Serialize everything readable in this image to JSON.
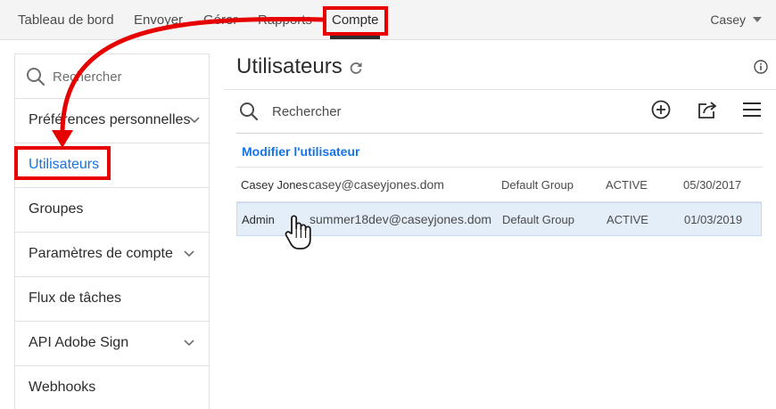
{
  "topnav": {
    "items": [
      {
        "label": "Tableau de bord"
      },
      {
        "label": "Envoyer"
      },
      {
        "label": "Gérer"
      },
      {
        "label": "Rapports"
      },
      {
        "label": "Compte"
      }
    ],
    "user": "Casey"
  },
  "sidebar": {
    "search_placeholder": "Rechercher",
    "items": [
      {
        "label": "Préférences personnelles",
        "expandable": true
      },
      {
        "label": "Utilisateurs",
        "selected": true
      },
      {
        "label": "Groupes"
      },
      {
        "label": "Paramètres de compte",
        "expandable": true
      },
      {
        "label": "Flux de tâches"
      },
      {
        "label": "API Adobe Sign",
        "expandable": true
      },
      {
        "label": "Webhooks"
      }
    ]
  },
  "main": {
    "title": "Utilisateurs",
    "search_label": "Rechercher",
    "edit_user": "Modifier l'utilisateur",
    "rows": [
      {
        "name": "Casey Jones",
        "email": "casey@caseyjones.dom",
        "group": "Default Group",
        "status": "ACTIVE",
        "date": "05/30/2017"
      },
      {
        "name": "Admin",
        "email": "summer18dev@caseyjones.dom",
        "group": "Default Group",
        "status": "ACTIVE",
        "date": "01/03/2019",
        "selected": true
      }
    ]
  },
  "colors": {
    "accent": "#1473e6",
    "annotation": "#e60000",
    "selected_row": "#e3eef9"
  }
}
